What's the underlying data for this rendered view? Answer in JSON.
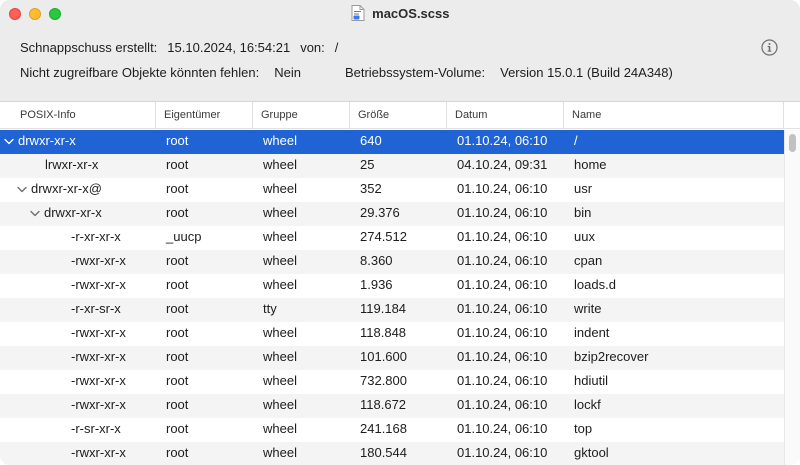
{
  "window": {
    "title": "macOS.scss"
  },
  "info": {
    "snapshot_label": "Schnappschuss erstellt:",
    "snapshot_value": "15.10.2024, 16:54:21",
    "from_label": "von:",
    "from_value": "/",
    "missing_label": "Nicht zugreifbare Objekte könnten fehlen:",
    "missing_value": "Nein",
    "volume_label": "Betriebssystem-Volume:",
    "volume_value": "Version 15.0.1 (Build 24A348)"
  },
  "table": {
    "columns": [
      "POSIX-Info",
      "Eigentümer",
      "Gruppe",
      "Größe",
      "Datum",
      "Name"
    ],
    "rows": [
      {
        "posix": "drwxr-xr-x",
        "owner": "root",
        "group": "wheel",
        "size": "640",
        "date": "01.10.24, 06:10",
        "name": "/",
        "level": 0,
        "expanded": true,
        "selected": true
      },
      {
        "posix": "lrwxr-xr-x",
        "owner": "root",
        "group": "wheel",
        "size": "25",
        "date": "04.10.24, 09:31",
        "name": "home",
        "level": 1,
        "expanded": false,
        "selected": false
      },
      {
        "posix": "drwxr-xr-x@",
        "owner": "root",
        "group": "wheel",
        "size": "352",
        "date": "01.10.24, 06:10",
        "name": "usr",
        "level": 1,
        "expanded": true,
        "selected": false
      },
      {
        "posix": "drwxr-xr-x",
        "owner": "root",
        "group": "wheel",
        "size": "29.376",
        "date": "01.10.24, 06:10",
        "name": "bin",
        "level": 2,
        "expanded": true,
        "selected": false
      },
      {
        "posix": "-r-xr-xr-x",
        "owner": "_uucp",
        "group": "wheel",
        "size": "274.512",
        "date": "01.10.24, 06:10",
        "name": "uux",
        "level": 3,
        "expanded": false,
        "selected": false
      },
      {
        "posix": "-rwxr-xr-x",
        "owner": "root",
        "group": "wheel",
        "size": "8.360",
        "date": "01.10.24, 06:10",
        "name": "cpan",
        "level": 3,
        "expanded": false,
        "selected": false
      },
      {
        "posix": "-rwxr-xr-x",
        "owner": "root",
        "group": "wheel",
        "size": "1.936",
        "date": "01.10.24, 06:10",
        "name": "loads.d",
        "level": 3,
        "expanded": false,
        "selected": false
      },
      {
        "posix": "-r-xr-sr-x",
        "owner": "root",
        "group": "tty",
        "size": "119.184",
        "date": "01.10.24, 06:10",
        "name": "write",
        "level": 3,
        "expanded": false,
        "selected": false
      },
      {
        "posix": "-rwxr-xr-x",
        "owner": "root",
        "group": "wheel",
        "size": "118.848",
        "date": "01.10.24, 06:10",
        "name": "indent",
        "level": 3,
        "expanded": false,
        "selected": false
      },
      {
        "posix": "-rwxr-xr-x",
        "owner": "root",
        "group": "wheel",
        "size": "101.600",
        "date": "01.10.24, 06:10",
        "name": "bzip2recover",
        "level": 3,
        "expanded": false,
        "selected": false
      },
      {
        "posix": "-rwxr-xr-x",
        "owner": "root",
        "group": "wheel",
        "size": "732.800",
        "date": "01.10.24, 06:10",
        "name": "hdiutil",
        "level": 3,
        "expanded": false,
        "selected": false
      },
      {
        "posix": "-rwxr-xr-x",
        "owner": "root",
        "group": "wheel",
        "size": "118.672",
        "date": "01.10.24, 06:10",
        "name": "lockf",
        "level": 3,
        "expanded": false,
        "selected": false
      },
      {
        "posix": "-r-sr-xr-x",
        "owner": "root",
        "group": "wheel",
        "size": "241.168",
        "date": "01.10.24, 06:10",
        "name": "top",
        "level": 3,
        "expanded": false,
        "selected": false
      },
      {
        "posix": "-rwxr-xr-x",
        "owner": "root",
        "group": "wheel",
        "size": "180.544",
        "date": "01.10.24, 06:10",
        "name": "gktool",
        "level": 3,
        "expanded": false,
        "selected": false
      }
    ]
  },
  "colors": {
    "selection": "#1f63d4",
    "alt_row": "#f4f4f4",
    "chrome": "#ececec"
  },
  "icons": {
    "document": "scss-document-icon",
    "info": "info-circle-icon",
    "disclosure": "chevron-down-icon"
  }
}
